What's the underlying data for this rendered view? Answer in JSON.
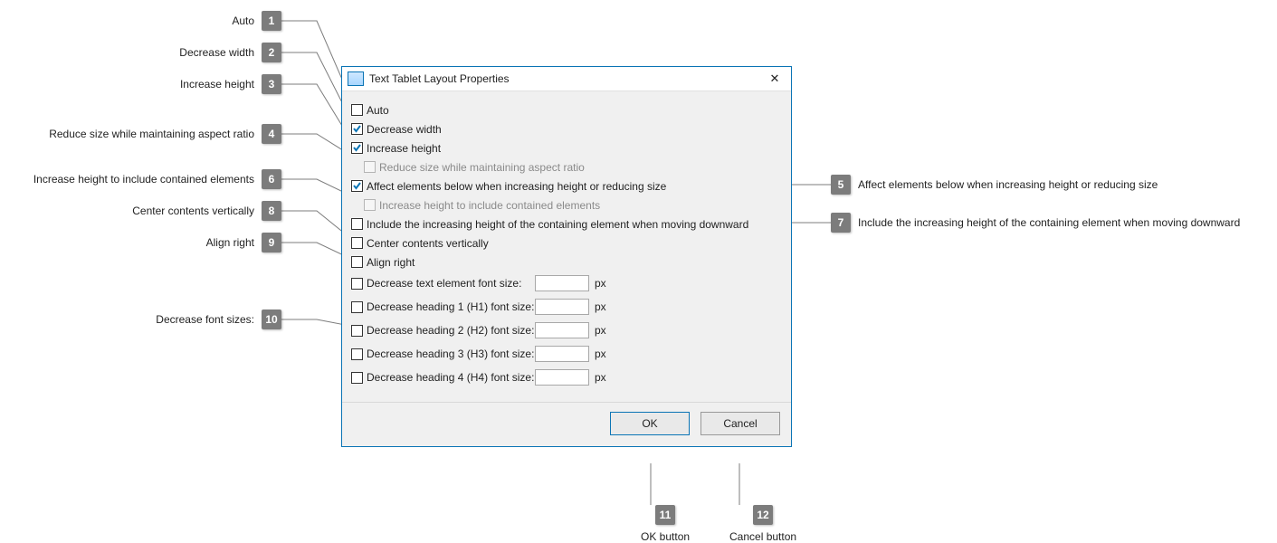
{
  "dialog": {
    "title": "Text Tablet Layout Properties",
    "options": {
      "auto": "Auto",
      "decrease_width": "Decrease width",
      "increase_height": "Increase height",
      "reduce_aspect": "Reduce size while maintaining aspect ratio",
      "affect_below": "Affect elements below when increasing height or reducing size",
      "increase_include": "Increase height to include contained elements",
      "include_moving": "Include the increasing height of the containing element when moving downward",
      "center_vert": "Center contents vertically",
      "align_right": "Align right"
    },
    "fontrows": {
      "text": "Decrease text element font size:",
      "h1": "Decrease heading 1 (H1) font size:",
      "h2": "Decrease heading 2 (H2) font size:",
      "h3": "Decrease heading 3 (H3) font size:",
      "h4": "Decrease heading 4 (H4) font size:",
      "unit": "px"
    },
    "buttons": {
      "ok": "OK",
      "cancel": "Cancel"
    }
  },
  "callouts": {
    "c1": {
      "n": "1",
      "t": "Auto"
    },
    "c2": {
      "n": "2",
      "t": "Decrease width"
    },
    "c3": {
      "n": "3",
      "t": "Increase height"
    },
    "c4": {
      "n": "4",
      "t": "Reduce size while maintaining aspect ratio"
    },
    "c5": {
      "n": "5",
      "t": "Affect elements below when increasing height or reducing size"
    },
    "c6": {
      "n": "6",
      "t": "Increase height to include contained elements"
    },
    "c7": {
      "n": "7",
      "t": "Include the increasing height of the containing element when moving downward"
    },
    "c8": {
      "n": "8",
      "t": "Center contents vertically"
    },
    "c9": {
      "n": "9",
      "t": "Align right"
    },
    "c10": {
      "n": "10",
      "t": "Decrease font sizes:"
    },
    "c11": {
      "n": "11",
      "t": "OK button"
    },
    "c12": {
      "n": "12",
      "t": "Cancel button"
    }
  }
}
